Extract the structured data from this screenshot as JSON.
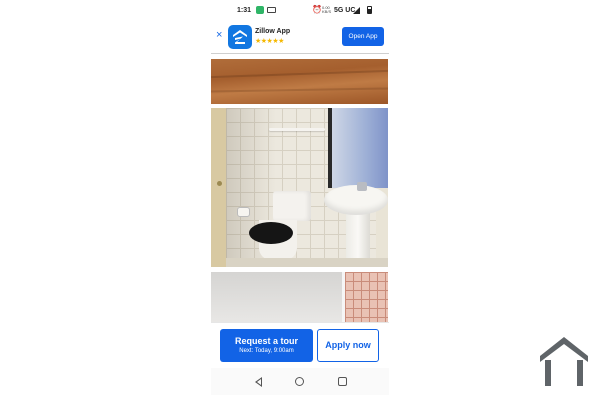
{
  "status_bar": {
    "time": "1:31",
    "speed": "0.00\nKB/S",
    "network": "5G UC",
    "icons": [
      "app-notification-icon",
      "photo-icon",
      "alarm-icon",
      "signal-icon",
      "battery-icon"
    ]
  },
  "ad_banner": {
    "app_name": "Zillow App",
    "rating_stars": "★★★★★",
    "open_label": "Open App",
    "close_icon": "×",
    "brand_color": "#1277e1"
  },
  "photos": [
    "wood-floor-photo",
    "bathroom-photo",
    "room-wall-photo"
  ],
  "actions": {
    "tour_label": "Request a tour",
    "tour_sub": "Next: Today, 9:00am",
    "apply_label": "Apply now",
    "accent_color": "#1263e6"
  },
  "nav": {
    "icons": [
      "back-icon",
      "home-icon",
      "recents-icon"
    ]
  },
  "watermark": {
    "icon": "house-outline-icon",
    "color": "#5f6468"
  }
}
